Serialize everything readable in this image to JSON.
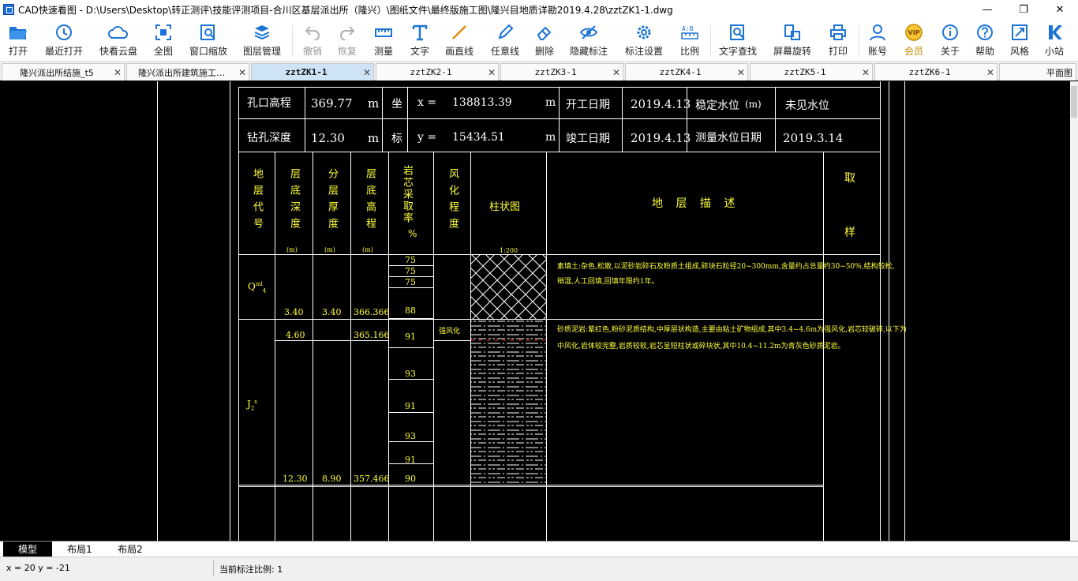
{
  "window": {
    "title": "CAD快速看图 - D:\\Users\\Desktop\\转正测评\\技能评测项目-合川区基层派出所（隆兴）\\图纸文件\\最终版施工图\\隆兴目地质详勘2019.4.28\\zztZK1-1.dwg",
    "minimize": "—",
    "maximize": "❐",
    "close": "✕"
  },
  "toolbar": [
    {
      "label": "打开",
      "icon": "folder-open-icon"
    },
    {
      "label": "最近打开",
      "icon": "history-icon"
    },
    {
      "label": "快看云盘",
      "icon": "cloud-icon"
    },
    {
      "label": "全图",
      "icon": "fit-all-icon"
    },
    {
      "label": "窗口缩放",
      "icon": "zoom-window-icon"
    },
    {
      "label": "图层管理",
      "icon": "layers-icon"
    },
    {
      "label": "撤销",
      "icon": "undo-icon",
      "disabled": true
    },
    {
      "label": "恢复",
      "icon": "redo-icon",
      "disabled": true
    },
    {
      "label": "测量",
      "icon": "ruler-icon"
    },
    {
      "label": "文字",
      "icon": "text-icon"
    },
    {
      "label": "画直线",
      "icon": "line-icon"
    },
    {
      "label": "任意线",
      "icon": "pen-icon"
    },
    {
      "label": "删除",
      "icon": "eraser-icon"
    },
    {
      "label": "隐藏标注",
      "icon": "eye-hide-icon"
    },
    {
      "label": "标注设置",
      "icon": "gear-icon"
    },
    {
      "label": "比例",
      "icon": "scale-icon"
    },
    {
      "label": "文字查找",
      "icon": "text-search-icon"
    },
    {
      "label": "屏幕旋转",
      "icon": "rotate-screen-icon"
    },
    {
      "label": "打印",
      "icon": "printer-icon"
    },
    {
      "label": "账号",
      "icon": "user-icon"
    },
    {
      "label": "会员",
      "icon": "vip-icon",
      "vip": true
    },
    {
      "label": "关于",
      "icon": "info-icon"
    },
    {
      "label": "帮助",
      "icon": "help-icon"
    },
    {
      "label": "风格",
      "icon": "style-icon"
    },
    {
      "label": "小站",
      "icon": "station-icon"
    }
  ],
  "tabs": [
    {
      "label": "隆兴派出所结施_t5",
      "close": "✕"
    },
    {
      "label": "隆兴派出所建筑施工…",
      "close": "✕"
    },
    {
      "label": "zztZK1-1",
      "close": "✕",
      "active": true
    },
    {
      "label": "zztZK2-1",
      "close": "✕"
    },
    {
      "label": "zztZK3-1",
      "close": "✕"
    },
    {
      "label": "zztZK4-1",
      "close": "✕"
    },
    {
      "label": "zztZK5-1",
      "close": "✕"
    },
    {
      "label": "zztZK6-1",
      "close": "✕"
    },
    {
      "label": "平面图",
      "close": ""
    }
  ],
  "drawing": {
    "header": {
      "kongkou_label": "孔口高程",
      "kongkou_value": "369.77",
      "kongkou_unit": "m",
      "zuankong_label": "钻孔深度",
      "zuankong_value": "12.30",
      "zuankong_unit": "m",
      "zuo": "坐",
      "biao": "标",
      "x_label": "x =",
      "x_value": "138813.39",
      "x_unit": "m",
      "y_label": "y =",
      "y_value": "15434.51",
      "y_unit": "m",
      "kaigong_label": "开工日期",
      "kaigong_value": "2019.4.13",
      "jungong_label": "竣工日期",
      "jungong_value": "2019.4.13",
      "wending_label": "稳定水位",
      "wending_unit": "(m)",
      "wending_value": "未见水位",
      "celiang_label": "测量水位日期",
      "celiang_value": "2019.3.14"
    },
    "columns": {
      "c1": "地层代号",
      "c2": "层底深度",
      "c2u": "(m)",
      "c3": "分层厚度",
      "c3u": "(m)",
      "c4": "层底高程",
      "c4u": "(m)",
      "c5": "岩芯采取率",
      "c5u": "%",
      "c6": "风化程度",
      "c7": "柱状图",
      "c7scale": "1:200",
      "c8": "地 层 描 述",
      "c9a": "取",
      "c9b": "样"
    },
    "layers": [
      {
        "code": "Q",
        "code_sup": "ml",
        "code_sub": "4",
        "depth": "3.40",
        "thickness": "3.40",
        "elevation": "366.366",
        "core_rates": [
          "75",
          "75",
          "75",
          "88"
        ],
        "weathering": "",
        "desc_line1": "素填土:杂色,松散,以泥砂岩碎石及粉质土组成,碎块石粒径20~300mm,含量约占总量约30~50%,结构较松,",
        "desc_line2": "稍湿,人工回填,回填年限约1年。"
      },
      {
        "code": "J",
        "code_sub": "2",
        "code_sup": "s",
        "depth_top": "4.60",
        "elevation_top": "365.166",
        "depth": "12.30",
        "thickness": "8.90",
        "elevation": "357.466",
        "core_rates": [
          "91",
          "93",
          "91",
          "93",
          "91",
          "90"
        ],
        "weathering": "强风化",
        "desc_line1": "砂质泥岩:紫红色,粉砂泥质结构,中厚层状构造,主要由粘土矿物组成,其中3.4~4.6m为强风化,岩芯较破碎,以下为",
        "desc_line2": "中风化,岩体较完整,岩质较软,岩芯呈短柱状或碎块状,其中10.4~11.2m为青灰色砂质泥岩。"
      }
    ]
  },
  "layout_tabs": [
    {
      "label": "模型",
      "active": true
    },
    {
      "label": "布局1"
    },
    {
      "label": "布局2"
    }
  ],
  "status": {
    "coords": "x = 20  y = -21",
    "scale": "当前标注比例: 1"
  }
}
